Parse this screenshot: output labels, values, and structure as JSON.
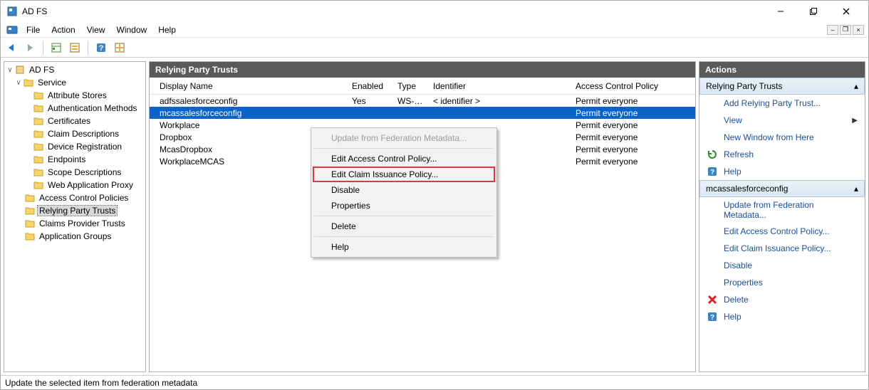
{
  "window": {
    "title": "AD FS"
  },
  "menus": {
    "file": "File",
    "action": "Action",
    "view": "View",
    "window": "Window",
    "help": "Help"
  },
  "tree": {
    "root": "AD FS",
    "service": "Service",
    "items": [
      "Attribute Stores",
      "Authentication Methods",
      "Certificates",
      "Claim Descriptions",
      "Device Registration",
      "Endpoints",
      "Scope Descriptions",
      "Web Application Proxy"
    ],
    "acp": "Access Control Policies",
    "rpt": "Relying Party Trusts",
    "cpt": "Claims Provider Trusts",
    "ag": "Application Groups"
  },
  "center": {
    "header": "Relying Party Trusts",
    "cols": {
      "name": "Display Name",
      "enabled": "Enabled",
      "type": "Type",
      "identifier": "Identifier",
      "acp": "Access Control Policy"
    },
    "rows": [
      {
        "name": "adfssalesforceconfig",
        "enabled": "Yes",
        "type": "WS-T...",
        "identifier": "< identifier >",
        "acp": "Permit everyone",
        "sel": false
      },
      {
        "name": "mcassalesforceconfig",
        "enabled": "",
        "type": "",
        "identifier": "",
        "acp": "Permit everyone",
        "sel": true
      },
      {
        "name": "Workplace",
        "enabled": "",
        "type": "",
        "identifier": "",
        "acp": "Permit everyone",
        "sel": false
      },
      {
        "name": "Dropbox",
        "enabled": "",
        "type": "",
        "identifier": "",
        "acp": "Permit everyone",
        "sel": false
      },
      {
        "name": "McasDropbox",
        "enabled": "",
        "type": "",
        "identifier": "",
        "acp": "Permit everyone",
        "sel": false
      },
      {
        "name": "WorkplaceMCAS",
        "enabled": "",
        "type": "",
        "identifier": "",
        "acp": "Permit everyone",
        "sel": false
      }
    ]
  },
  "ctx": {
    "update": "Update from Federation Metadata...",
    "eacp": "Edit Access Control Policy...",
    "ecip": "Edit Claim Issuance Policy...",
    "disable": "Disable",
    "props": "Properties",
    "delete": "Delete",
    "help": "Help"
  },
  "actions": {
    "header": "Actions",
    "g1": "Relying Party Trusts",
    "add": "Add Relying Party Trust...",
    "view": "View",
    "newwin": "New Window from Here",
    "refresh": "Refresh",
    "help": "Help",
    "g2": "mcassalesforceconfig",
    "ufm": "Update from Federation Metadata...",
    "eacp": "Edit Access Control Policy...",
    "ecip": "Edit Claim Issuance Policy...",
    "disable": "Disable",
    "props": "Properties",
    "delete": "Delete",
    "help2": "Help"
  },
  "status": "Update the selected item from federation metadata",
  "colwidths": {
    "name": 270,
    "enabled": 64,
    "type": 50,
    "identifier": 200,
    "acp": 160
  }
}
